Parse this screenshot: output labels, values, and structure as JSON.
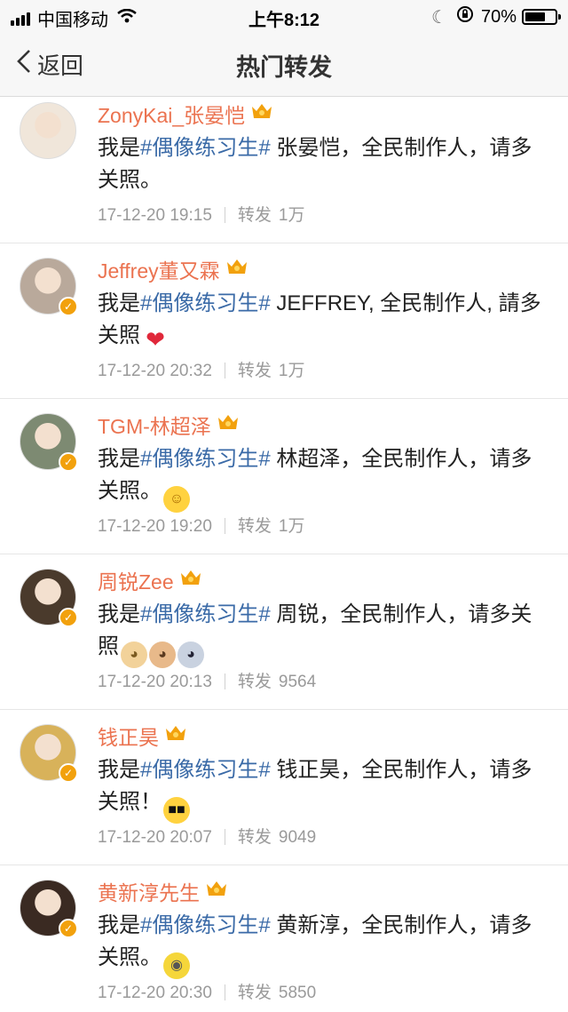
{
  "status_bar": {
    "carrier": "中国移动",
    "time": "上午8:12",
    "battery": "70%",
    "battery_level": 0.7
  },
  "nav": {
    "back_label": "返回",
    "title": "热门转发"
  },
  "posts": [
    {
      "user": "ZonyKai_张晏恺",
      "prefix": "我是",
      "hashtag": "#偶像练习生#",
      "body": " 张晏恺，全民制作人，请多关照。",
      "time": "17-12-20 19:15",
      "repost_label": "转发",
      "repost_count": "1万",
      "avatar_color": "#f0e6da",
      "verified": false,
      "emojis": []
    },
    {
      "user": "Jeffrey董又霖",
      "prefix": "我是",
      "hashtag": "#偶像练习生#",
      "body": " JEFFREY, 全民制作人, 請多关照",
      "time": "17-12-20 20:32",
      "repost_label": "转发",
      "repost_count": "1万",
      "avatar_color": "#b9a99b",
      "verified": true,
      "emojis": [
        {
          "name": "heart-emoji",
          "glyph": "❤",
          "color": "#e0283a",
          "bg": "transparent"
        }
      ]
    },
    {
      "user": "TGM-林超泽",
      "prefix": "我是",
      "hashtag": "#偶像练习生#",
      "body": " 林超泽，全民制作人，请多关照。",
      "time": "17-12-20 19:20",
      "repost_label": "转发",
      "repost_count": "1万",
      "avatar_color": "#7d8a72",
      "verified": true,
      "emojis": [
        {
          "name": "sun-emoji",
          "glyph": "☺",
          "color": "#a86a00",
          "bg": "#ffd23f"
        }
      ]
    },
    {
      "user": "周锐Zee",
      "prefix": "我是",
      "hashtag": "#偶像练习生#",
      "body": " 周锐，全民制作人，请多关照",
      "time": "17-12-20 20:13",
      "repost_label": "转发",
      "repost_count": "9564",
      "avatar_color": "#4a3a2c",
      "verified": true,
      "emojis": [
        {
          "name": "doge-emoji",
          "glyph": "◕",
          "color": "#7a5a20",
          "bg": "#f2d29a"
        },
        {
          "name": "cat-emoji",
          "glyph": "◕",
          "color": "#5a3a20",
          "bg": "#e8b98a"
        },
        {
          "name": "husky-emoji",
          "glyph": "◕",
          "color": "#223",
          "bg": "#c9d2e0"
        }
      ]
    },
    {
      "user": "钱正昊",
      "prefix": "我是",
      "hashtag": "#偶像练习生#",
      "body": " 钱正昊，全民制作人，请多关照！",
      "time": "17-12-20 20:07",
      "repost_label": "转发",
      "repost_count": "9049",
      "avatar_color": "#d8b25a",
      "verified": true,
      "emojis": [
        {
          "name": "sunglasses-emoji",
          "glyph": "■■",
          "color": "#111",
          "bg": "#ffd23f"
        }
      ]
    },
    {
      "user": "黄新淳先生",
      "prefix": "我是",
      "hashtag": "#偶像练习生#",
      "body": " 黄新淳，全民制作人，请多关照。",
      "time": "17-12-20 20:30",
      "repost_label": "转发",
      "repost_count": "5850",
      "avatar_color": "#3a2a22",
      "verified": true,
      "emojis": [
        {
          "name": "minion-emoji",
          "glyph": "◉",
          "color": "#555",
          "bg": "#f5d63a"
        }
      ]
    }
  ]
}
